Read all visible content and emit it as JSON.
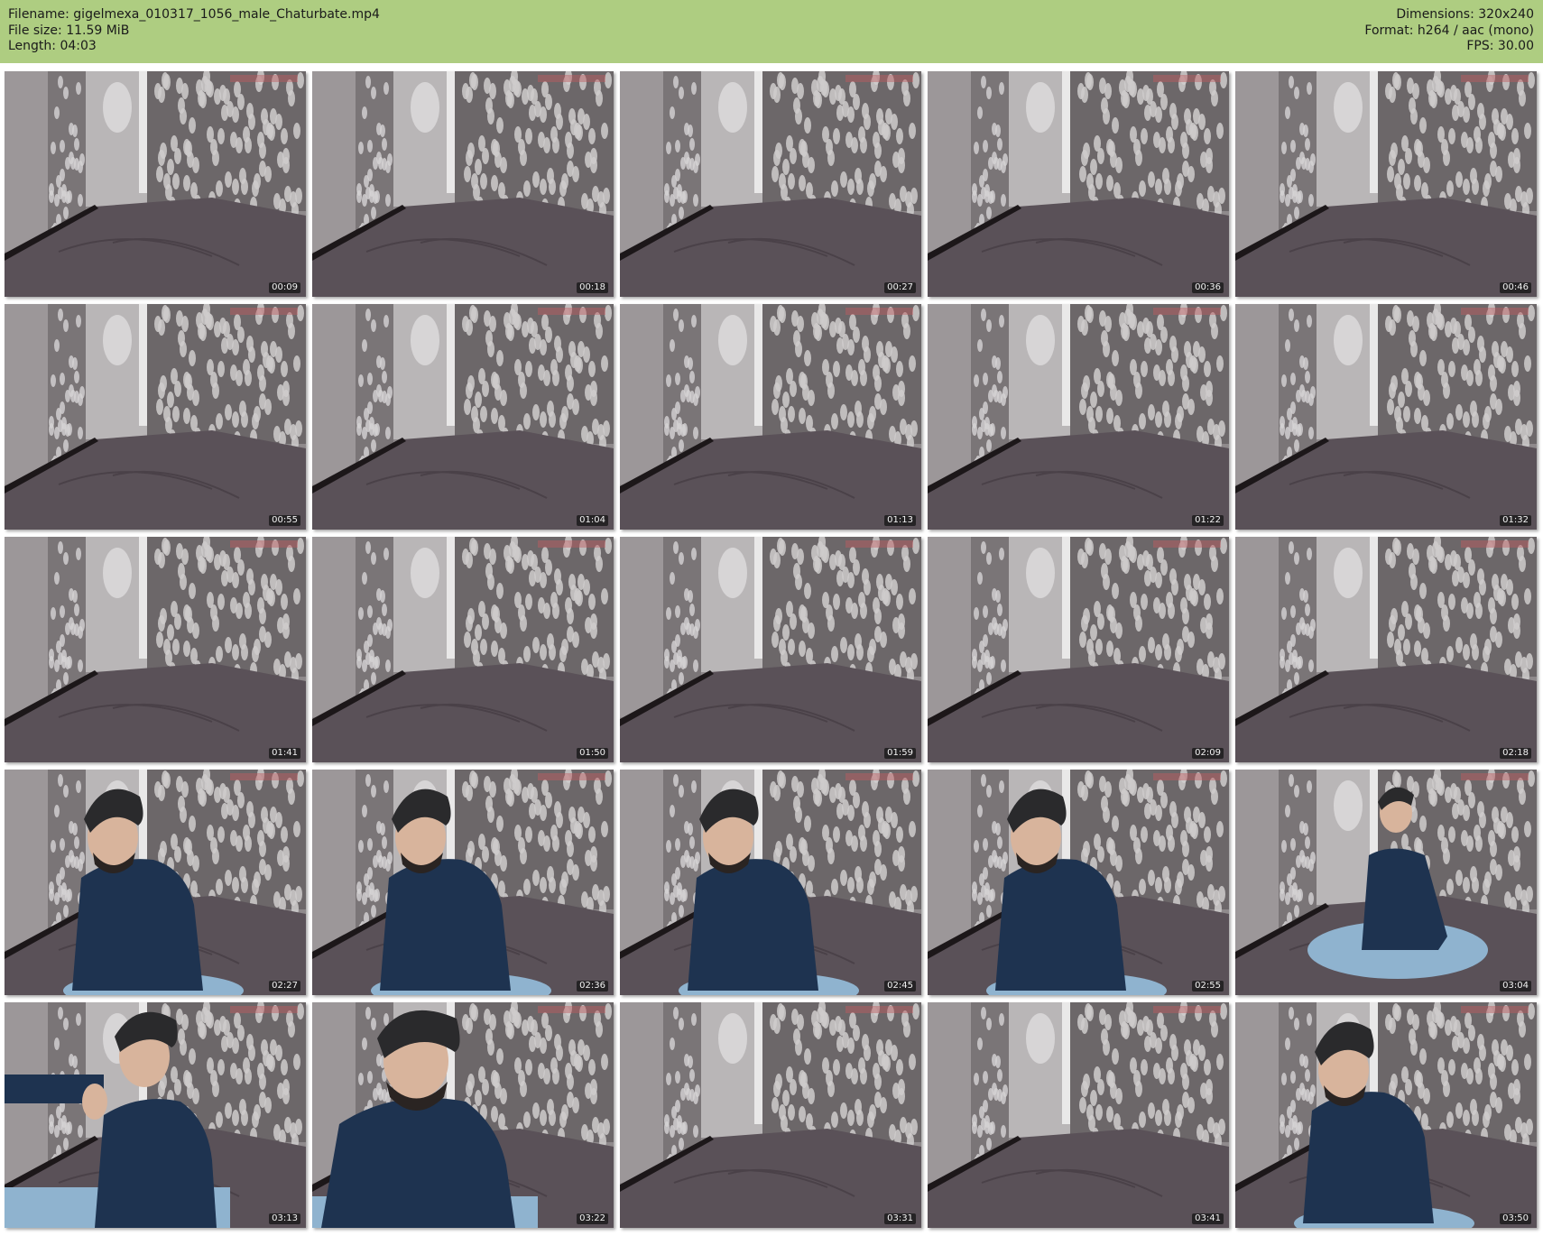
{
  "meta": {
    "filename_line": "Filename: gigelmexa_010317_1056_male_Chaturbate.mp4",
    "filesize_line": "File size: 11.59 MiB",
    "length_line": "Length: 04:03",
    "dimensions_line": "Dimensions: 320x240",
    "format_line": "Format: h264 / aac (mono)",
    "fps_line": "FPS: 30.00"
  },
  "colors": {
    "header_bg": "#aecd81",
    "wall": "#8f8a8c",
    "bed": "#5a5158",
    "shirt": "#1e3350",
    "jeans": "#8fb3cf"
  },
  "thumbnails": [
    {
      "time": "00:09",
      "person": "none"
    },
    {
      "time": "00:18",
      "person": "none"
    },
    {
      "time": "00:27",
      "person": "none"
    },
    {
      "time": "00:36",
      "person": "none"
    },
    {
      "time": "00:46",
      "person": "none"
    },
    {
      "time": "00:55",
      "person": "none"
    },
    {
      "time": "01:04",
      "person": "none"
    },
    {
      "time": "01:13",
      "person": "none"
    },
    {
      "time": "01:22",
      "person": "none"
    },
    {
      "time": "01:32",
      "person": "none"
    },
    {
      "time": "01:41",
      "person": "none"
    },
    {
      "time": "01:50",
      "person": "none"
    },
    {
      "time": "01:59",
      "person": "none"
    },
    {
      "time": "02:09",
      "person": "none"
    },
    {
      "time": "02:18",
      "person": "none"
    },
    {
      "time": "02:27",
      "person": "seated"
    },
    {
      "time": "02:36",
      "person": "seated"
    },
    {
      "time": "02:45",
      "person": "seated"
    },
    {
      "time": "02:55",
      "person": "seated"
    },
    {
      "time": "03:04",
      "person": "far"
    },
    {
      "time": "03:13",
      "person": "arm-raised"
    },
    {
      "time": "03:22",
      "person": "close"
    },
    {
      "time": "03:31",
      "person": "none"
    },
    {
      "time": "03:41",
      "person": "none"
    },
    {
      "time": "03:50",
      "person": "seated"
    }
  ]
}
